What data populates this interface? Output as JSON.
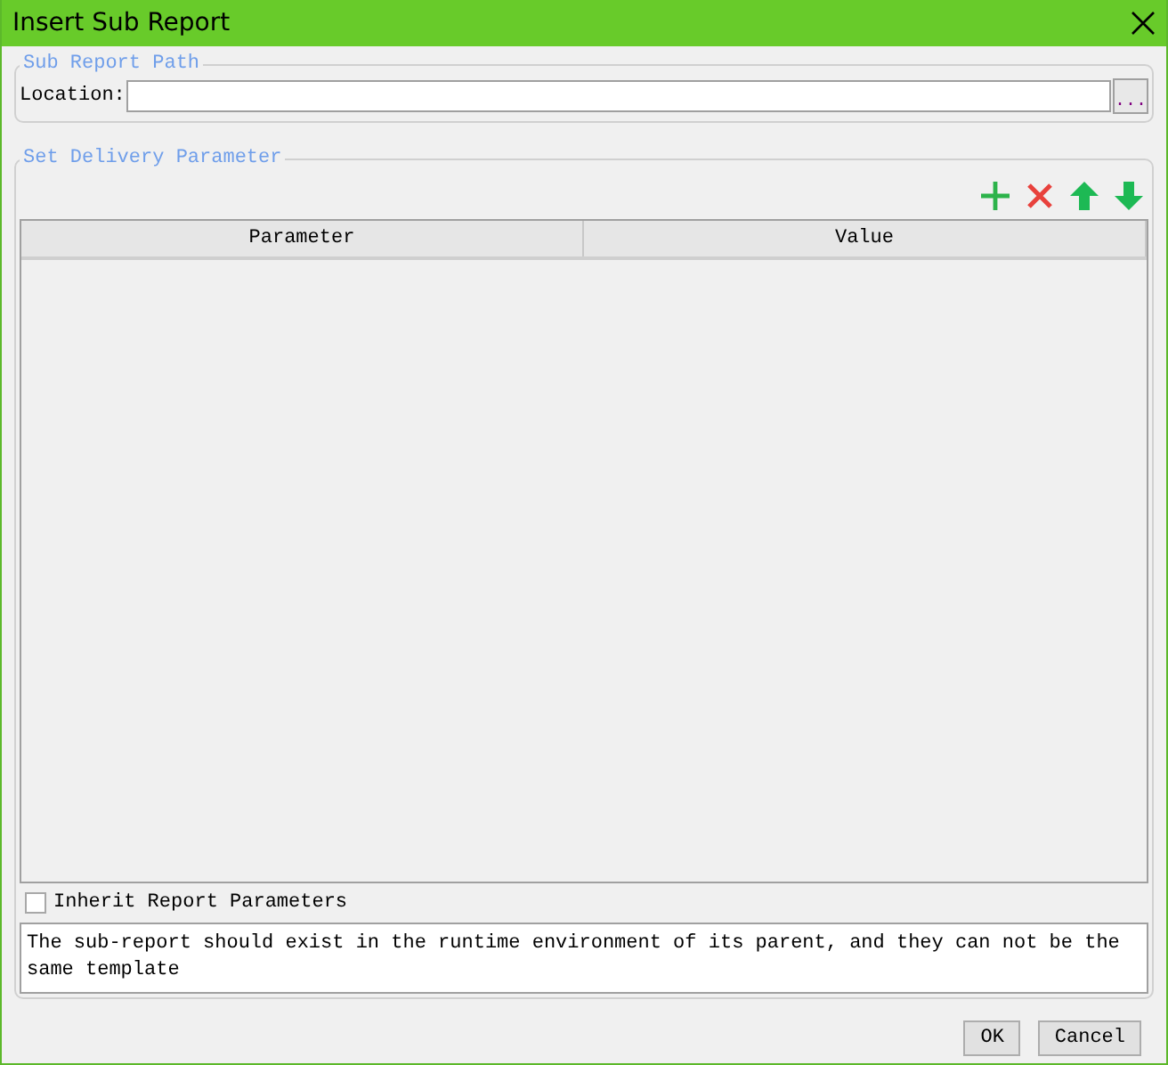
{
  "window": {
    "title": "Insert Sub Report"
  },
  "sub_report_path": {
    "legend": "Sub Report Path",
    "location_label": "Location:",
    "browse_button": "..."
  },
  "delivery_parameter": {
    "legend": "Set Delivery Parameter",
    "table": {
      "columns": [
        "Parameter",
        "Value"
      ]
    },
    "inherit_checkbox": {
      "label": "Inherit Report Parameters",
      "checked": false
    },
    "description": "The sub-report should exist in the runtime environment of its parent, and they can not be the same template"
  },
  "buttons": [
    "OK",
    "Cancel"
  ]
}
